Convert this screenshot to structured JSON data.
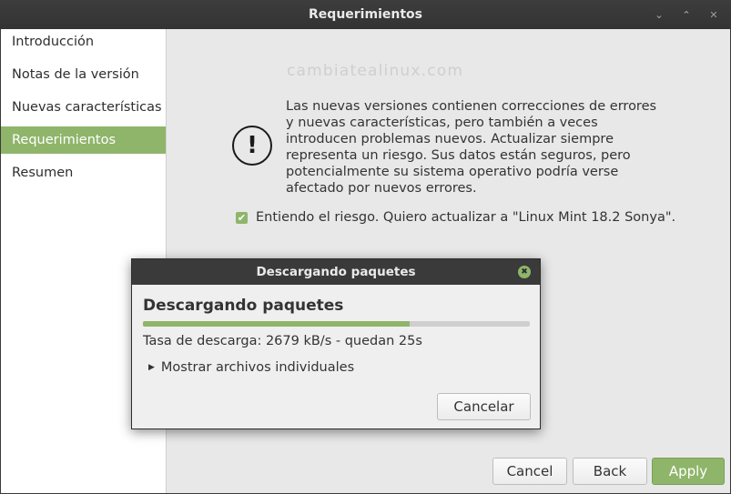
{
  "window": {
    "title": "Requerimientos",
    "controls": {
      "minimize": "⌄",
      "maximize": "⌃",
      "close": "✕"
    }
  },
  "sidebar": {
    "items": [
      {
        "label": "Introducción"
      },
      {
        "label": "Notas de la versión"
      },
      {
        "label": "Nuevas características"
      },
      {
        "label": "Requerimientos",
        "active": true
      },
      {
        "label": "Resumen"
      }
    ]
  },
  "main": {
    "watermark": "cambiatealinux.com",
    "warning_icon_glyph": "!",
    "description": "Las nuevas versiones contienen correcciones de errores y nuevas características, pero también a veces introducen problemas nuevos. Actualizar siempre representa un riesgo. Sus datos están seguros, pero potencialmente su sistema operativo podría verse afectado por nuevos errores.",
    "agree_checkbox_checked": true,
    "agree_label": "Entiendo el riesgo. Quiero actualizar a \"Linux Mint 18.2 Sonya\"."
  },
  "buttons": {
    "cancel": "Cancel",
    "back": "Back",
    "apply": "Apply"
  },
  "dialog": {
    "title": "Descargando paquetes",
    "close_glyph": "✖",
    "heading": "Descargando paquetes",
    "progress_fraction": 0.69,
    "rate_text": "Tasa de descarga: 2679 kB/s - quedan 25s",
    "expander_label": "Mostrar archivos individuales",
    "cancel_label": "Cancelar"
  },
  "colors": {
    "accent": "#8fb56b",
    "titlebar": "#3a3a3a",
    "window_bg": "#e8e8e8"
  }
}
